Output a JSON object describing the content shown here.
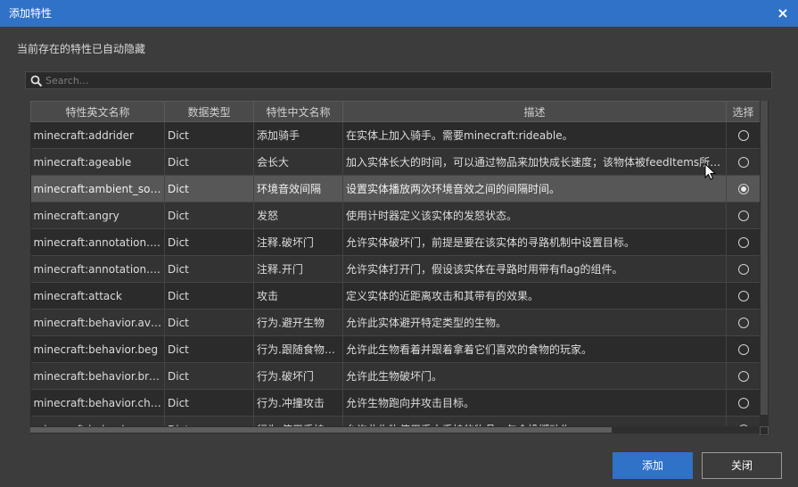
{
  "dialog": {
    "title": "添加特性",
    "close_icon": "×",
    "hint": "当前存在的特性已自动隐藏"
  },
  "search": {
    "placeholder": "Search...",
    "value": ""
  },
  "table": {
    "columns": [
      "特性英文名称",
      "数据类型",
      "特性中文名称",
      "描述",
      "选择"
    ],
    "rows": [
      {
        "name": "minecraft:addrider",
        "type": "Dict",
        "cn": "添加骑手",
        "desc": "在实体上加入骑手。需要minecraft:rideable。",
        "selected": false
      },
      {
        "name": "minecraft:ageable",
        "type": "Dict",
        "cn": "会长大",
        "desc": "加入实体长大的时间，可以通过物品来加快成长速度；该物体被feedItems所…",
        "selected": false
      },
      {
        "name": "minecraft:ambient_sou…",
        "type": "Dict",
        "cn": "环境音效间隔",
        "desc": "设置实体播放两次环境音效之间的间隔时间。",
        "selected": true
      },
      {
        "name": "minecraft:angry",
        "type": "Dict",
        "cn": "发怒",
        "desc": "使用计时器定义该实体的发怒状态。",
        "selected": false
      },
      {
        "name": "minecraft:annotation.b…",
        "type": "Dict",
        "cn": "注释.破坏门",
        "desc": "允许实体破坏门，前提是要在该实体的寻路机制中设置目标。",
        "selected": false
      },
      {
        "name": "minecraft:annotation.o…",
        "type": "Dict",
        "cn": "注释.开门",
        "desc": "允许实体打开门，假设该实体在寻路时用带有flag的组件。",
        "selected": false
      },
      {
        "name": "minecraft:attack",
        "type": "Dict",
        "cn": "攻击",
        "desc": "定义实体的近距离攻击和其带有的效果。",
        "selected": false
      },
      {
        "name": "minecraft:behavior.avo…",
        "type": "Dict",
        "cn": "行为.避开生物",
        "desc": "允许此实体避开特定类型的生物。",
        "selected": false
      },
      {
        "name": "minecraft:behavior.beg",
        "type": "Dict",
        "cn": "行为.跟随食物…",
        "desc": "允许此生物看着并跟着拿着它们喜欢的食物的玩家。",
        "selected": false
      },
      {
        "name": "minecraft:behavior.bre…",
        "type": "Dict",
        "cn": "行为.破坏门",
        "desc": "允许此生物破坏门。",
        "selected": false
      },
      {
        "name": "minecraft:behavior.cha…",
        "type": "Dict",
        "cn": "行为.冲撞攻击",
        "desc": "允许生物跑向并攻击目标。",
        "selected": false
      },
      {
        "name": "minecraft:behavior.cel…",
        "type": "Dict",
        "cn": "行为.使用手持…",
        "desc": "允许此生物使用手中手持的物品，包含投掷动作。",
        "selected": false
      }
    ]
  },
  "buttons": {
    "add": "添加",
    "close": "关闭"
  },
  "icons": {
    "search": "search-icon",
    "close": "close-icon",
    "radio": "radio-icon",
    "cursor": "mouse-cursor-icon"
  },
  "colors": {
    "accent": "#2f72c8",
    "background": "#3c3c3c",
    "selected_row": "#575757"
  }
}
